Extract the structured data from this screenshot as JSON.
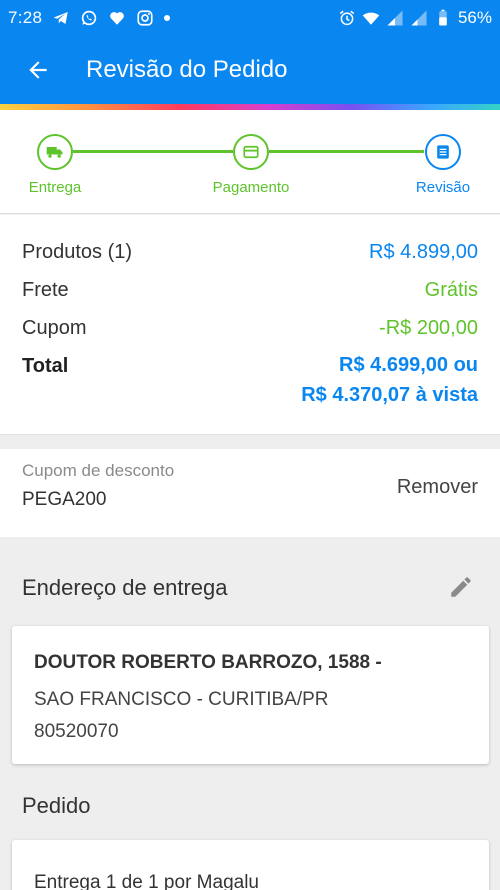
{
  "status_bar": {
    "time": "7:28",
    "battery": "56%",
    "left_icons": [
      "telegram-icon",
      "whatsapp-icon",
      "heart-icon",
      "instagram-icon",
      "dot-icon"
    ],
    "right_icons": [
      "alarm-icon",
      "wifi-icon",
      "signal-icon",
      "signal-icon",
      "battery-icon"
    ]
  },
  "app_bar": {
    "title": "Revisão do Pedido",
    "back_icon": "arrow-back-icon"
  },
  "stepper": {
    "steps": [
      {
        "label": "Entrega",
        "icon": "truck-icon",
        "state": "done"
      },
      {
        "label": "Pagamento",
        "icon": "credit-card-icon",
        "state": "done"
      },
      {
        "label": "Revisão",
        "icon": "list-icon",
        "state": "active"
      }
    ]
  },
  "summary": {
    "products_label": "Produtos (1)",
    "products_value": "R$ 4.899,00",
    "shipping_label": "Frete",
    "shipping_value": "Grátis",
    "coupon_label": "Cupom",
    "coupon_value": "-R$ 200,00",
    "total_label": "Total",
    "total_value_installments": "R$ 4.699,00 ou",
    "total_value_cash": "R$ 4.370,07 à vista"
  },
  "coupon": {
    "label": "Cupom de desconto",
    "code": "PEGA200",
    "remove_label": "Remover"
  },
  "address": {
    "section_title": "Endereço de entrega",
    "line1": "DOUTOR ROBERTO BARROZO, 1588 -",
    "line2": "SAO FRANCISCO - CURITIBA/PR",
    "line3": "80520070"
  },
  "order": {
    "section_title": "Pedido",
    "delivery_line": "Entrega 1 de 1 por Magalu"
  },
  "colors": {
    "primary": "#0a86f1",
    "success": "#5fc32b",
    "background": "#eeeeee"
  }
}
